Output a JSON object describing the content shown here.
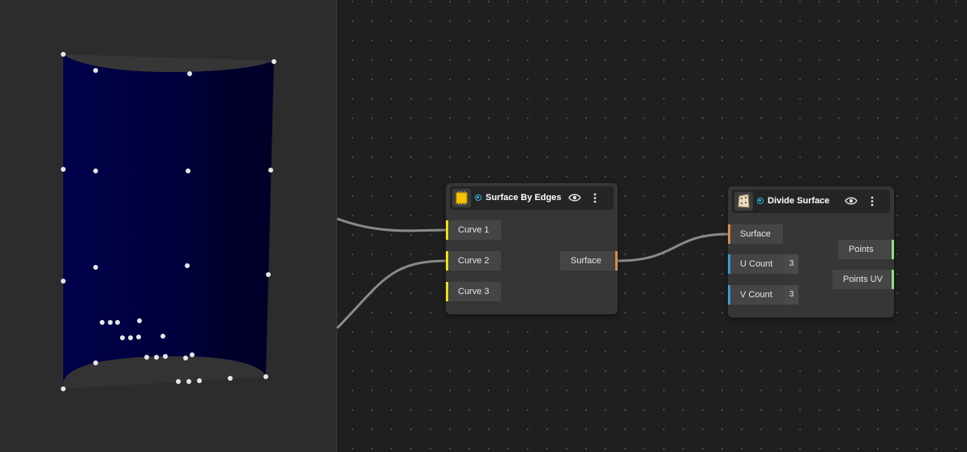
{
  "viewport": {
    "surface_color": "#000044",
    "ground_color": "#333333",
    "point_color": "#e6e6e6"
  },
  "colors": {
    "curve_port": "#f0e010",
    "surface_port": "#d98a45",
    "number_port": "#3b9bd6",
    "points_port": "#8fe07a",
    "status": "#2bb3d6",
    "wire": "#8a8a8a"
  },
  "nodes": {
    "surface_by_edges": {
      "icon": "chip-icon",
      "title": "Surface By Edges",
      "inputs": [
        {
          "label": "Curve 1"
        },
        {
          "label": "Curve 2"
        },
        {
          "label": "Curve 3"
        }
      ],
      "outputs": [
        {
          "label": "Surface"
        }
      ]
    },
    "divide_surface": {
      "icon": "divide-surface-icon",
      "title": "Divide Surface",
      "inputs": [
        {
          "label": "Surface"
        },
        {
          "label": "U Count",
          "value": "3"
        },
        {
          "label": "V Count",
          "value": "3"
        }
      ],
      "outputs": [
        {
          "label": "Points"
        },
        {
          "label": "Points UV"
        }
      ]
    }
  }
}
